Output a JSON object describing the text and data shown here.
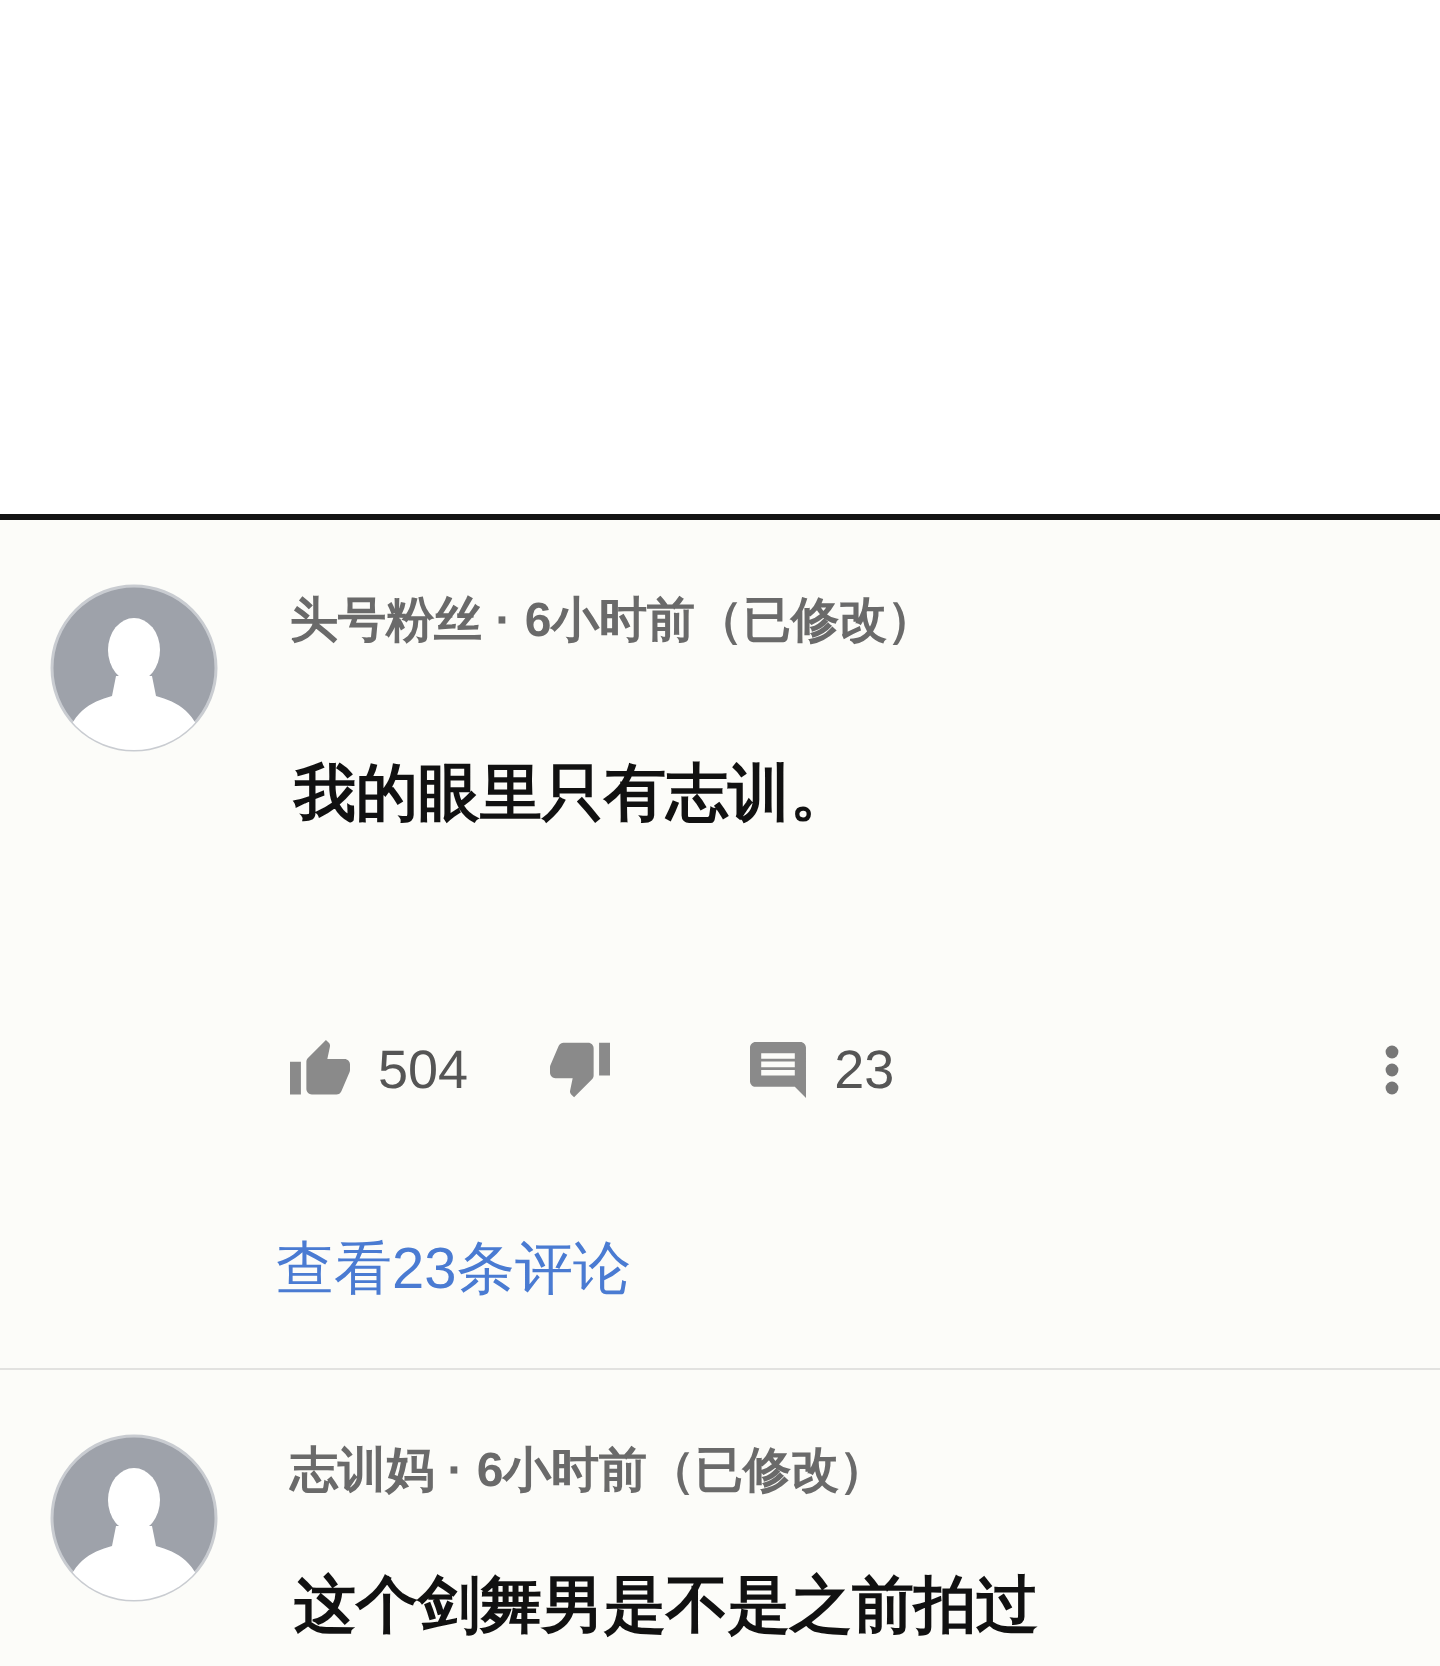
{
  "comments": [
    {
      "meta": "头号粉丝 · 6小时前（已修改）",
      "text": "我的眼里只有志训。",
      "actions": {
        "likes": "504",
        "replies": "23"
      },
      "view_replies": "查看23条评论"
    },
    {
      "meta": "志训妈 · 6小时前（已修改）",
      "text": "这个剑舞男是不是之前拍过"
    }
  ]
}
